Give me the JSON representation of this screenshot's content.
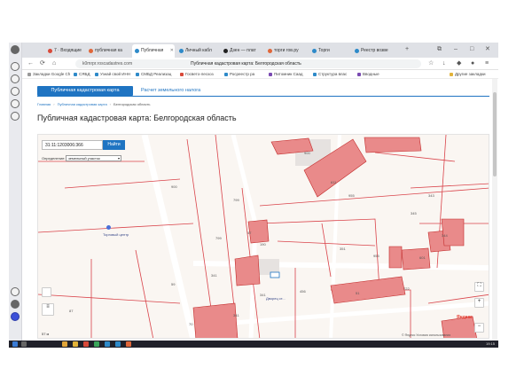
{
  "browser": {
    "tabs": [
      {
        "label": "7 · Входящие",
        "color": "#d84a3a"
      },
      {
        "label": "публичная ка",
        "color": "#e0673a"
      },
      {
        "label": "Публичная ",
        "color": "#2e8ac9"
      },
      {
        "label": "Личный кабл",
        "color": "#2e8ac9"
      },
      {
        "label": "Дзен — плат",
        "color": "#222222"
      },
      {
        "label": "торги гов.ру",
        "color": "#e0673a"
      },
      {
        "label": "Торги",
        "color": "#2e8ac9"
      },
      {
        "label": "Реестр возве",
        "color": "#2e8ac9"
      }
    ],
    "url": "k0mrpr.roscadastres.com",
    "page_title_in_bar": "Публичная кадастровая карта: Белгородская область",
    "bookmarks": [
      {
        "label": "Закладки Google Ch",
        "color": "#999999"
      },
      {
        "label": "СЯБД",
        "color": "#2e8ac9"
      },
      {
        "label": "Узнай свой ИНН",
        "color": "#2e8ac9"
      },
      {
        "label": "СМБД Реализац",
        "color": "#2e8ac9"
      },
      {
        "label": "Госвето-лесхоз",
        "color": "#d84a3a"
      },
      {
        "label": "Росреестр ра",
        "color": "#2e8ac9"
      },
      {
        "label": "Питомник Саад",
        "color": "#7a4ab2"
      },
      {
        "label": "Структура влас",
        "color": "#2e8ac9"
      },
      {
        "label": "Вводные",
        "color": "#7a4ab2"
      },
      {
        "label": "Другие закладки",
        "color": "#e2b33a"
      }
    ]
  },
  "page": {
    "tab_pkk": "Публичная кадастровая карта",
    "tab_calc": "Расчет земельного налога",
    "breadcrumbs": [
      "Главная",
      "Публичная кадастровая карта",
      "Белгородская область"
    ],
    "title": "Публичная кадастровая карта: Белгородская область"
  },
  "map": {
    "search_value": "31:11:1203006:366",
    "search_button": "Найти",
    "define_label": "Определение:",
    "define_value": "земельный участок",
    "poi_mall": "Торговый центр",
    "poi_other": "Дворец ст...",
    "scale": "57 м",
    "yandex": "Яндекс",
    "copyright": "© Яндекс  Условия использования",
    "zoom_in": "+",
    "zoom_out": "−"
  },
  "taskbar": {
    "time": "19:15"
  },
  "colors": {
    "accent": "#1f74c2",
    "parcel": "#e98a8a",
    "parcel_stroke": "#c22a2a",
    "boundary": "#d9434a"
  }
}
